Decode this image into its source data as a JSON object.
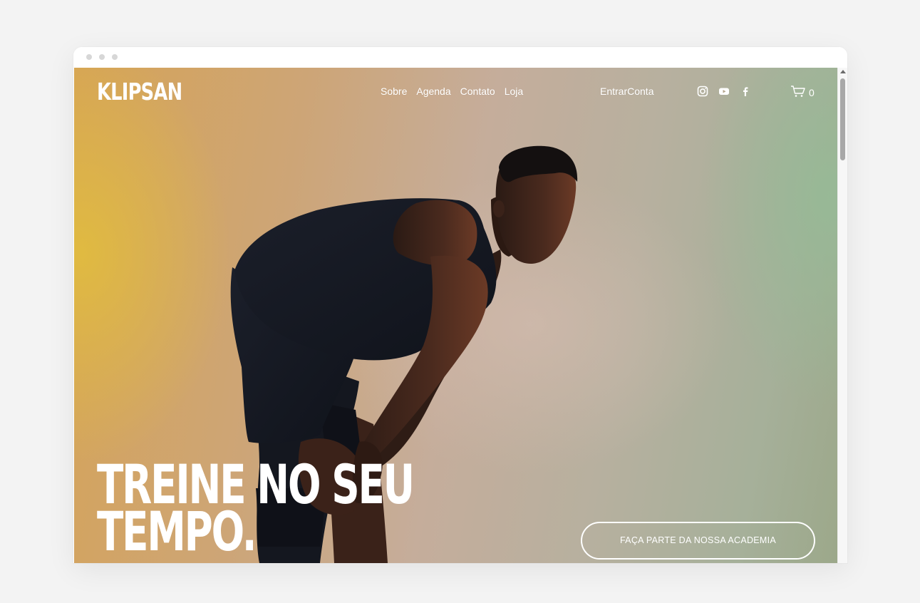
{
  "window": {
    "controls": [
      "close",
      "minimize",
      "maximize"
    ]
  },
  "header": {
    "logo": "KLIPSAN",
    "nav": [
      {
        "label": "Sobre"
      },
      {
        "label": "Agenda"
      },
      {
        "label": "Contato"
      },
      {
        "label": "Loja"
      }
    ],
    "login": "EntrarConta",
    "social": [
      "instagram-icon",
      "youtube-icon",
      "facebook-icon"
    ],
    "cart": {
      "icon": "cart-icon",
      "count": "0"
    }
  },
  "hero": {
    "headline_line1": "TREINE NO SEU",
    "headline_line2": "TEMPO.",
    "cta": "FAÇA PARTE DA NOSSA ACADEMIA",
    "image": "athlete-photo"
  },
  "colors": {
    "text": "#ffffff",
    "bg_warm": "#d6a456",
    "bg_cool": "#9cb59a"
  }
}
